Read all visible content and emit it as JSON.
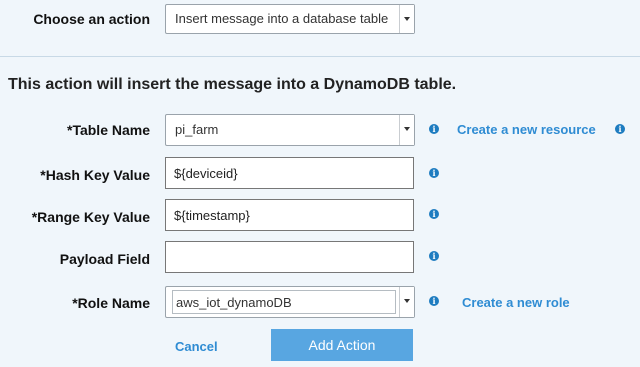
{
  "choose_action": {
    "label": "Choose an action",
    "selected": "Insert message into a database table"
  },
  "description": "This action will insert the message into a DynamoDB table.",
  "fields": {
    "table_name": {
      "label": "*Table Name",
      "value": "pi_farm",
      "link": "Create a new resource"
    },
    "hash_key": {
      "label": "*Hash Key Value",
      "value": "${deviceid}"
    },
    "range_key": {
      "label": "*Range Key Value",
      "value": "${timestamp}"
    },
    "payload": {
      "label": "Payload Field",
      "value": ""
    },
    "role_name": {
      "label": "*Role Name",
      "value": "aws_iot_dynamoDB",
      "link": "Create a new role"
    }
  },
  "actions": {
    "cancel": "Cancel",
    "add": "Add Action"
  },
  "info_glyph": "i",
  "colors": {
    "accent": "#2f8cd3",
    "primary_button": "#58a6e1",
    "info_icon": "#1e7cc0",
    "background": "#f0f6fb"
  }
}
